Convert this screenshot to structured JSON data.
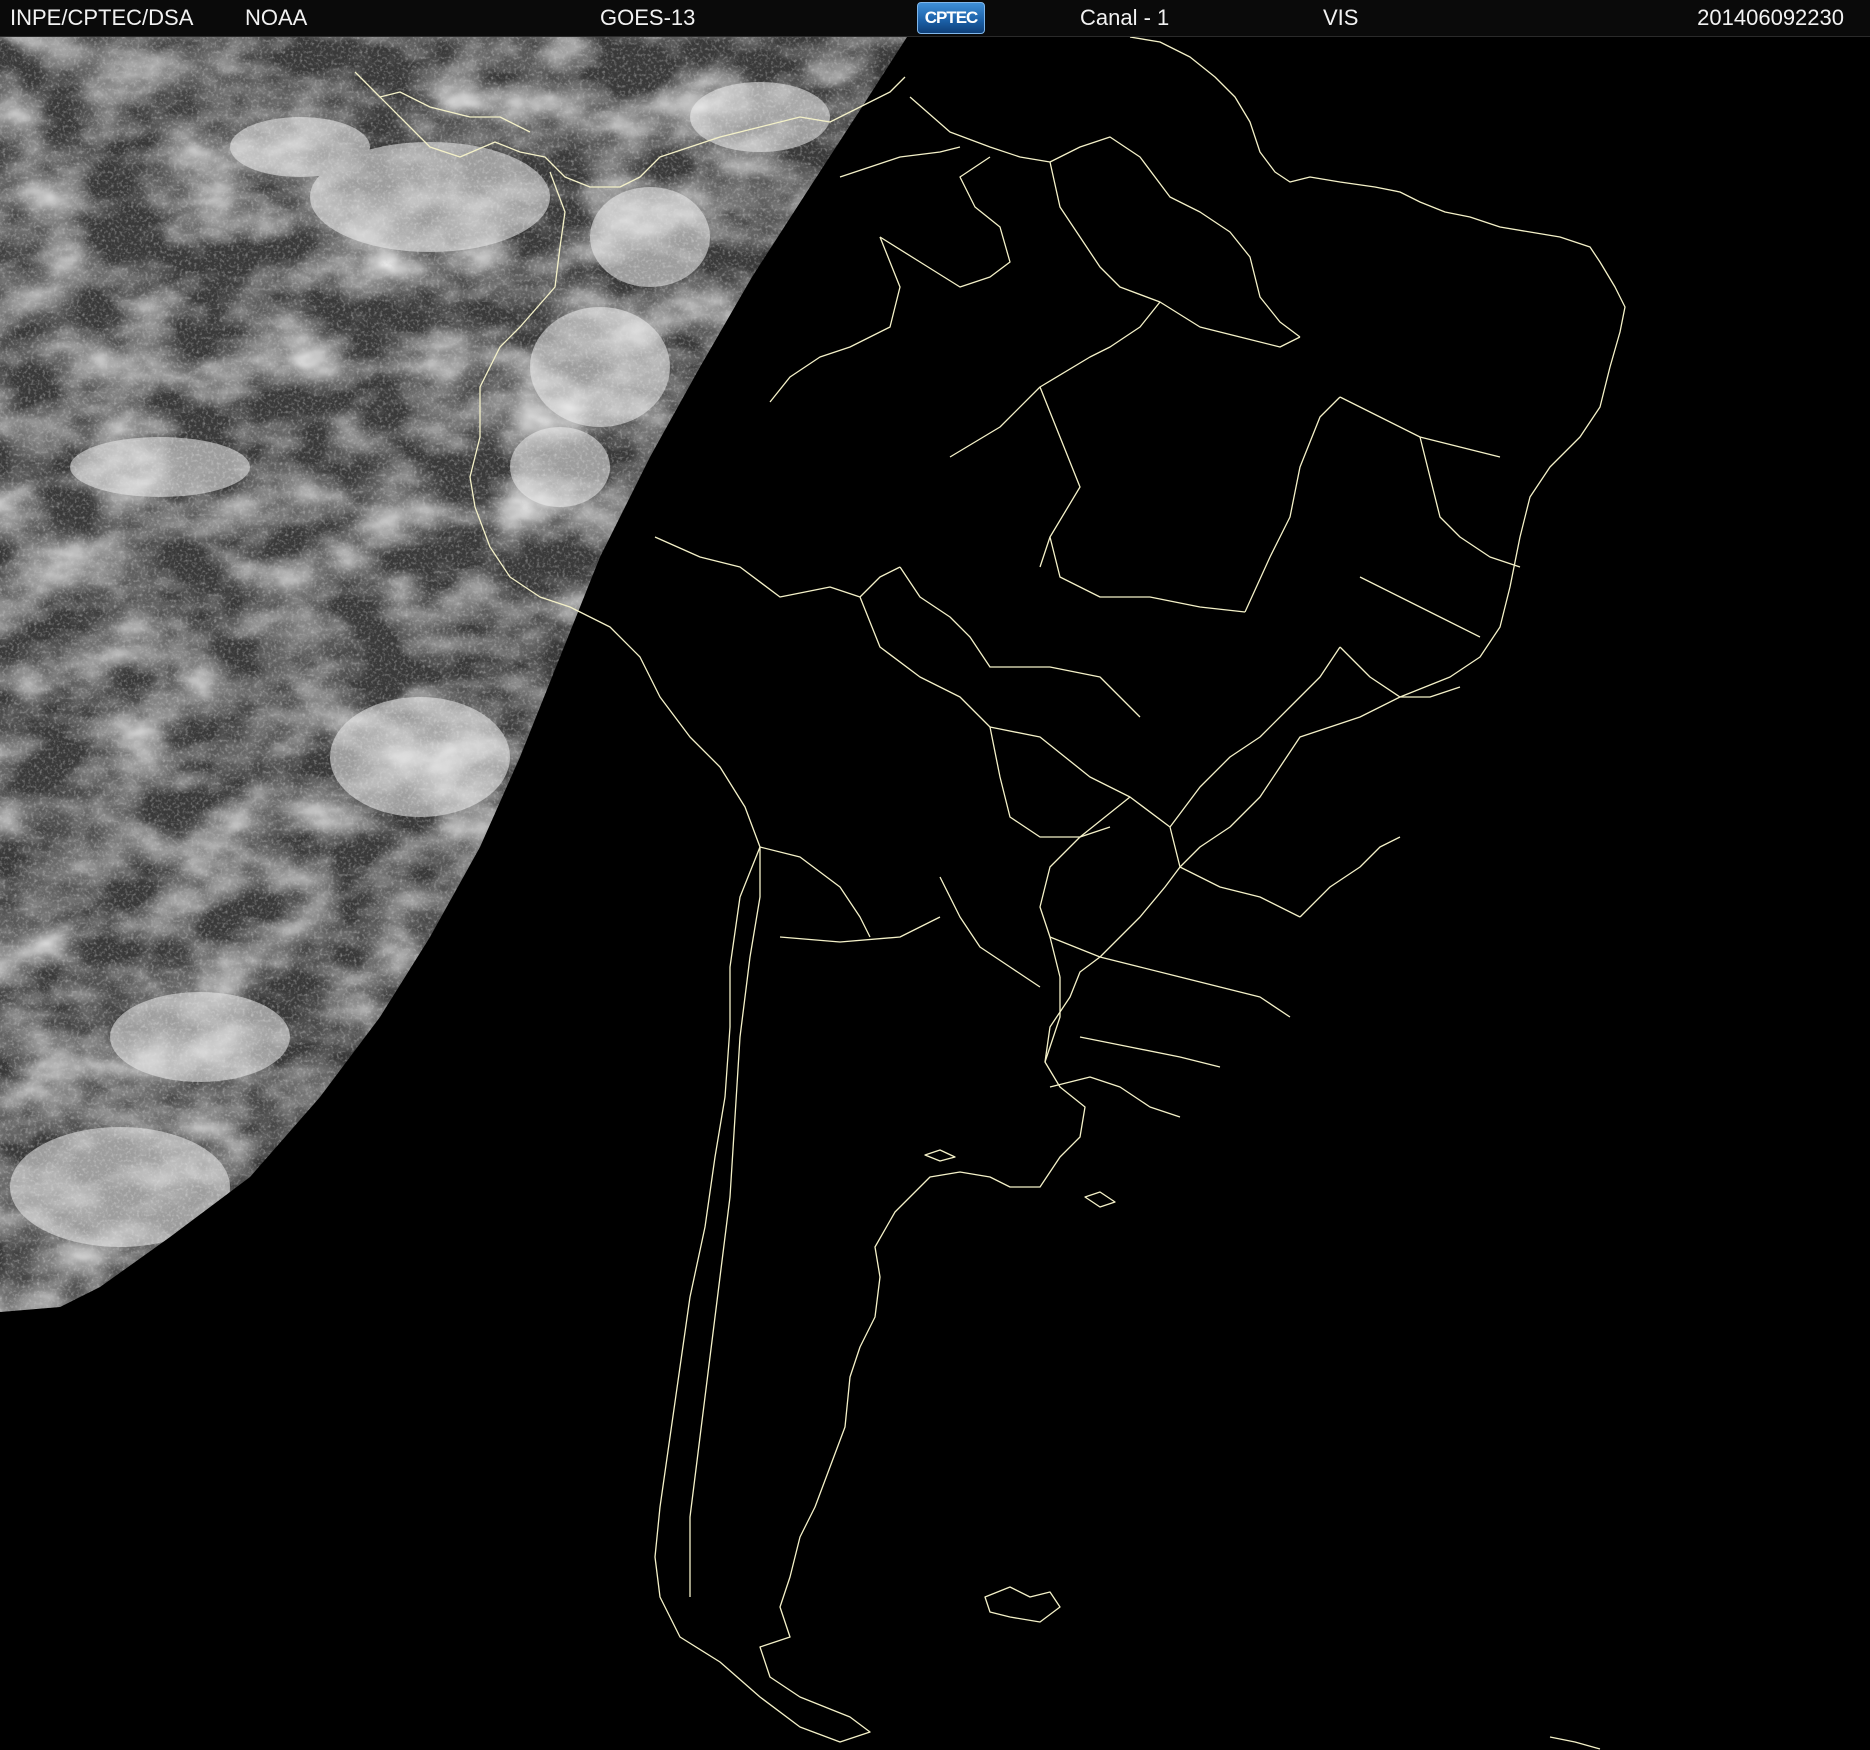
{
  "header": {
    "organization": "INPE/CPTEC/DSA",
    "agency": "NOAA",
    "satellite": "GOES-13",
    "logo_text": "CPTEC",
    "channel": "Canal - 1",
    "band": "VIS",
    "timestamp": "201406092230"
  },
  "image": {
    "background_color": "#000000",
    "coastline_color": "#f4f1c8",
    "cloud_color": "#e6e6e6",
    "daylit_ocean_color": "#3a3a3a"
  }
}
